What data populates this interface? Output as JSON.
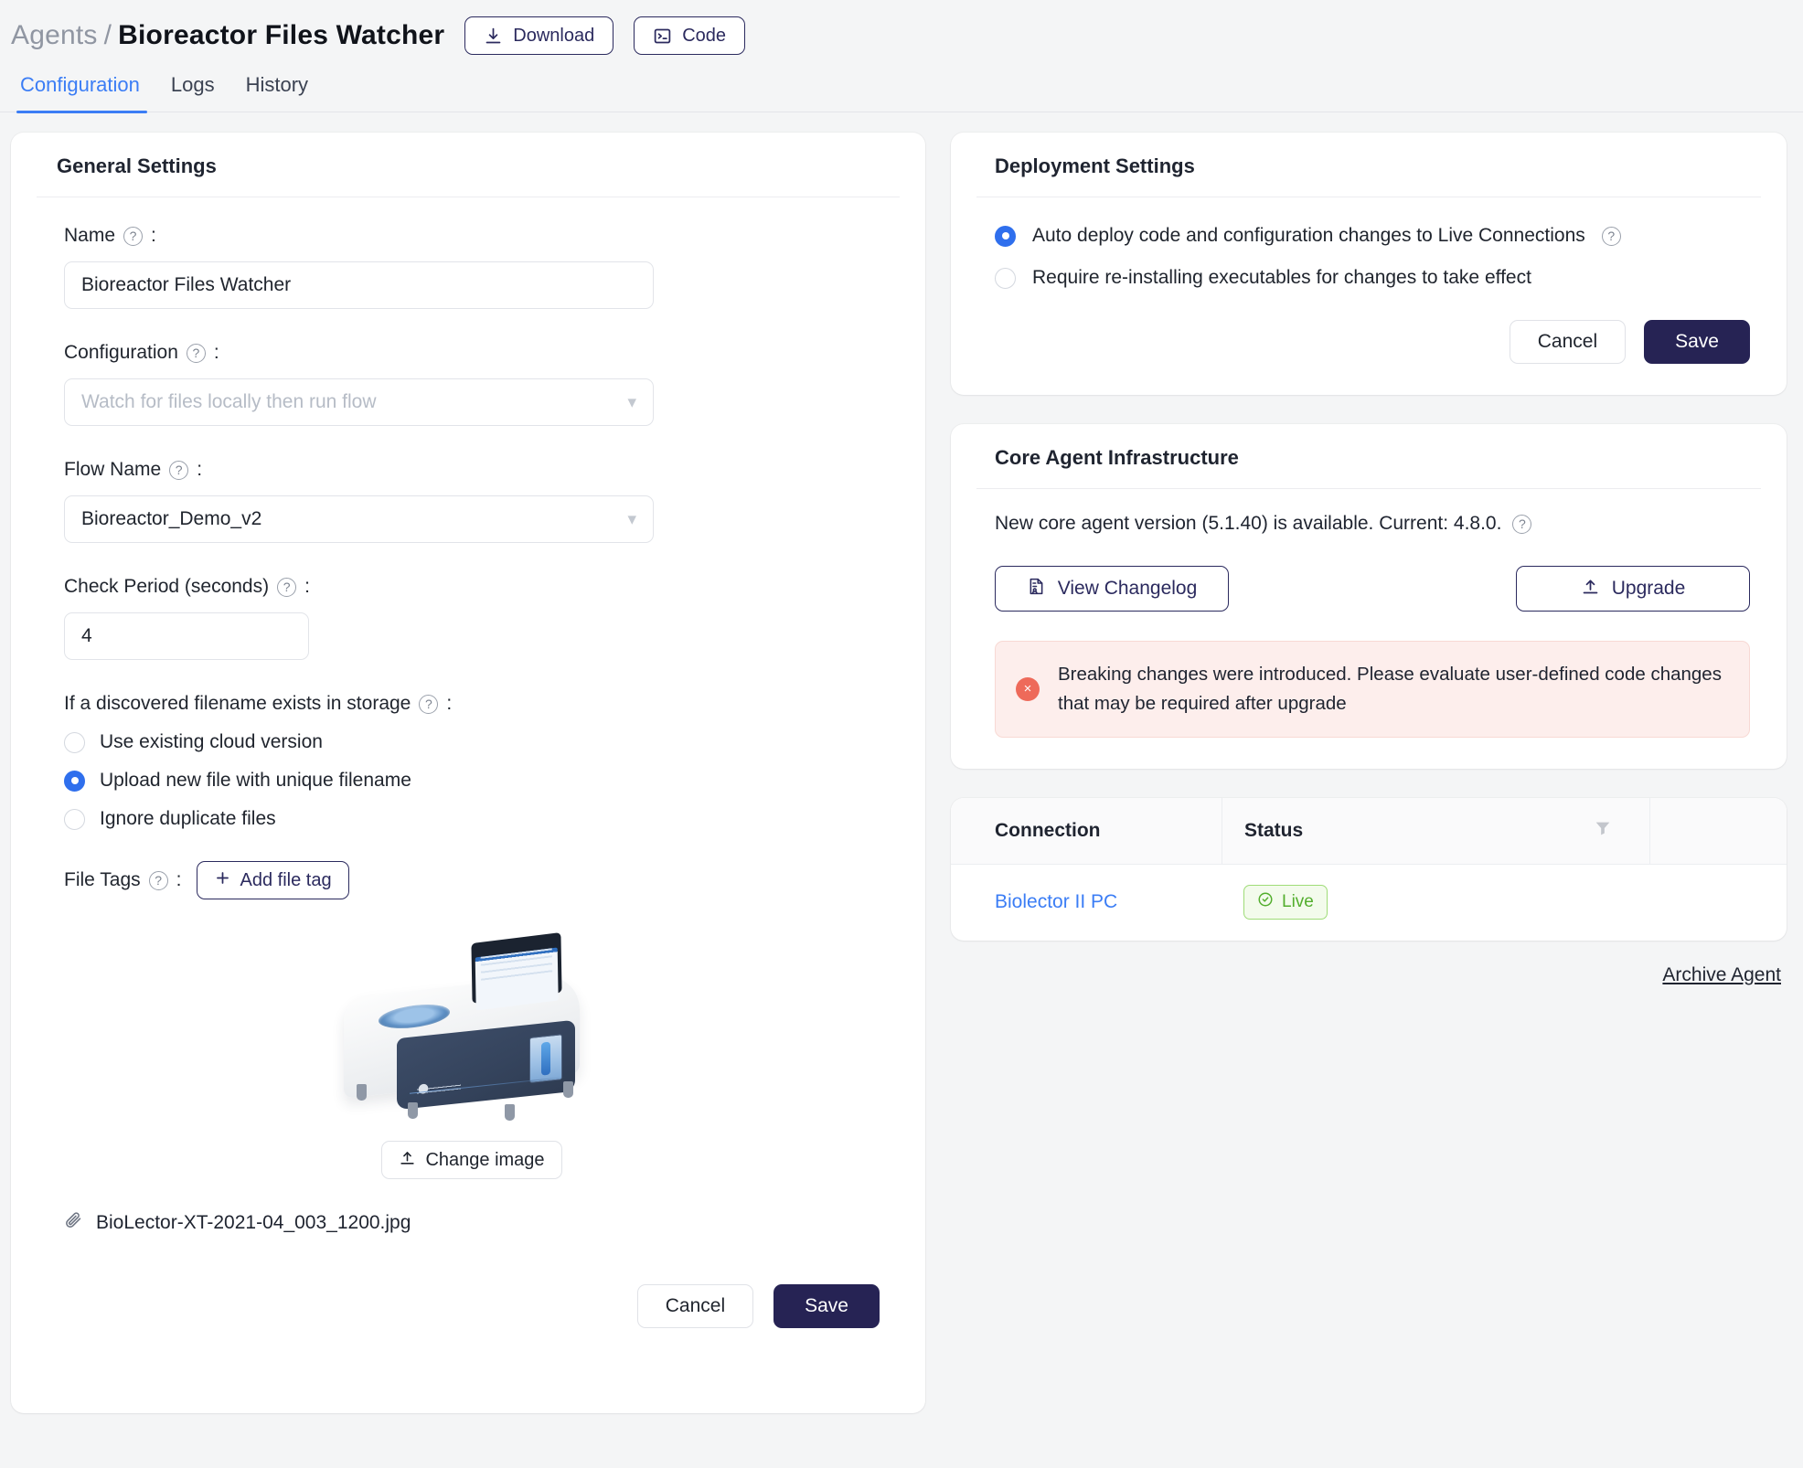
{
  "header": {
    "breadcrumb_parent": "Agents",
    "breadcrumb_sep": "/",
    "breadcrumb_current": "Bioreactor Files Watcher",
    "download_label": "Download",
    "code_label": "Code"
  },
  "tabs": [
    {
      "label": "Configuration",
      "active": true
    },
    {
      "label": "Logs",
      "active": false
    },
    {
      "label": "History",
      "active": false
    }
  ],
  "general": {
    "title": "General Settings",
    "name_label": "Name",
    "name_value": "Bioreactor Files Watcher",
    "configuration_label": "Configuration",
    "configuration_value": "Watch for files locally then run flow",
    "flow_label": "Flow Name",
    "flow_value": "Bioreactor_Demo_v2",
    "check_period_label": "Check Period (seconds)",
    "check_period_value": "4",
    "duplicate_label": "If a discovered filename exists in storage",
    "duplicate_options": [
      {
        "label": "Use existing cloud version",
        "selected": false
      },
      {
        "label": "Upload new file with unique filename",
        "selected": true
      },
      {
        "label": "Ignore duplicate files",
        "selected": false
      }
    ],
    "file_tags_label": "File Tags",
    "add_file_tag_label": "Add file tag",
    "change_image_label": "Change image",
    "image_filename": "BioLector-XT-2021-04_003_1200.jpg",
    "cancel_label": "Cancel",
    "save_label": "Save",
    "colon": ":",
    "help_glyph": "?"
  },
  "deployment": {
    "title": "Deployment Settings",
    "options": [
      {
        "label": "Auto deploy code and configuration changes to Live Connections",
        "selected": true,
        "has_help": true
      },
      {
        "label": "Require re-installing executables for changes to take effect",
        "selected": false,
        "has_help": false
      }
    ],
    "cancel_label": "Cancel",
    "save_label": "Save"
  },
  "core_agent": {
    "title": "Core Agent Infrastructure",
    "version_text": "New core agent version (5.1.40) is available. Current: 4.8.0.",
    "new_version": "5.1.40",
    "current_version": "4.8.0",
    "changelog_label": "View Changelog",
    "upgrade_label": "Upgrade",
    "alert_text": "Breaking changes were introduced. Please evaluate user-defined code changes that may be required after upgrade",
    "alert_glyph": "×"
  },
  "connections": {
    "columns": [
      "Connection",
      "Status"
    ],
    "rows": [
      {
        "connection": "Biolector II PC",
        "status": "Live"
      }
    ],
    "archive_label": "Archive Agent"
  },
  "colors": {
    "accent_blue": "#3b7df5",
    "navy": "#262354",
    "status_green": "#53ae2e",
    "alert_red": "#ee6a5a",
    "page_bg": "#f4f5f6"
  }
}
